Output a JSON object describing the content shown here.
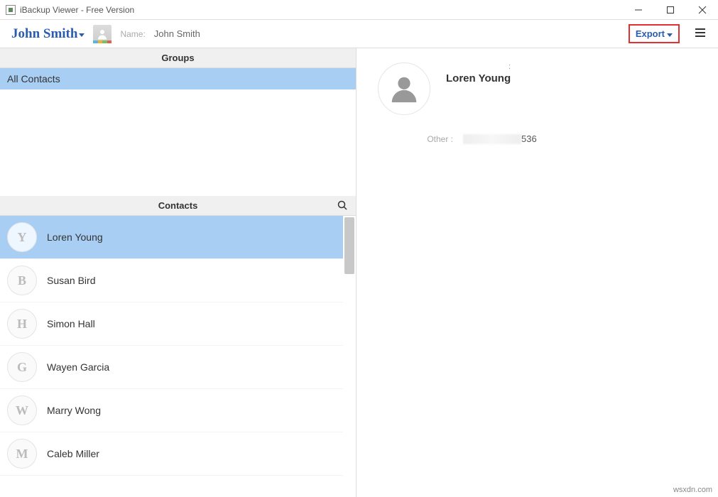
{
  "window": {
    "title": "iBackup Viewer - Free Version"
  },
  "toolbar": {
    "device_name": "John Smith",
    "name_label": "Name:",
    "name_value": "John Smith",
    "export_label": "Export"
  },
  "groups": {
    "header": "Groups",
    "items": [
      {
        "label": "All Contacts",
        "selected": true
      }
    ]
  },
  "contacts": {
    "header": "Contacts",
    "items": [
      {
        "initial": "Y",
        "name": "Loren Young",
        "selected": true
      },
      {
        "initial": "B",
        "name": "Susan Bird",
        "selected": false
      },
      {
        "initial": "H",
        "name": "Simon Hall",
        "selected": false
      },
      {
        "initial": "G",
        "name": "Wayen Garcia",
        "selected": false
      },
      {
        "initial": "W",
        "name": "Marry Wong",
        "selected": false
      },
      {
        "initial": "M",
        "name": "Caleb Miller",
        "selected": false
      }
    ]
  },
  "detail": {
    "name": "Loren Young",
    "fields": [
      {
        "label": "Other :",
        "value_suffix": "536"
      }
    ]
  },
  "watermark": "wsxdn.com"
}
